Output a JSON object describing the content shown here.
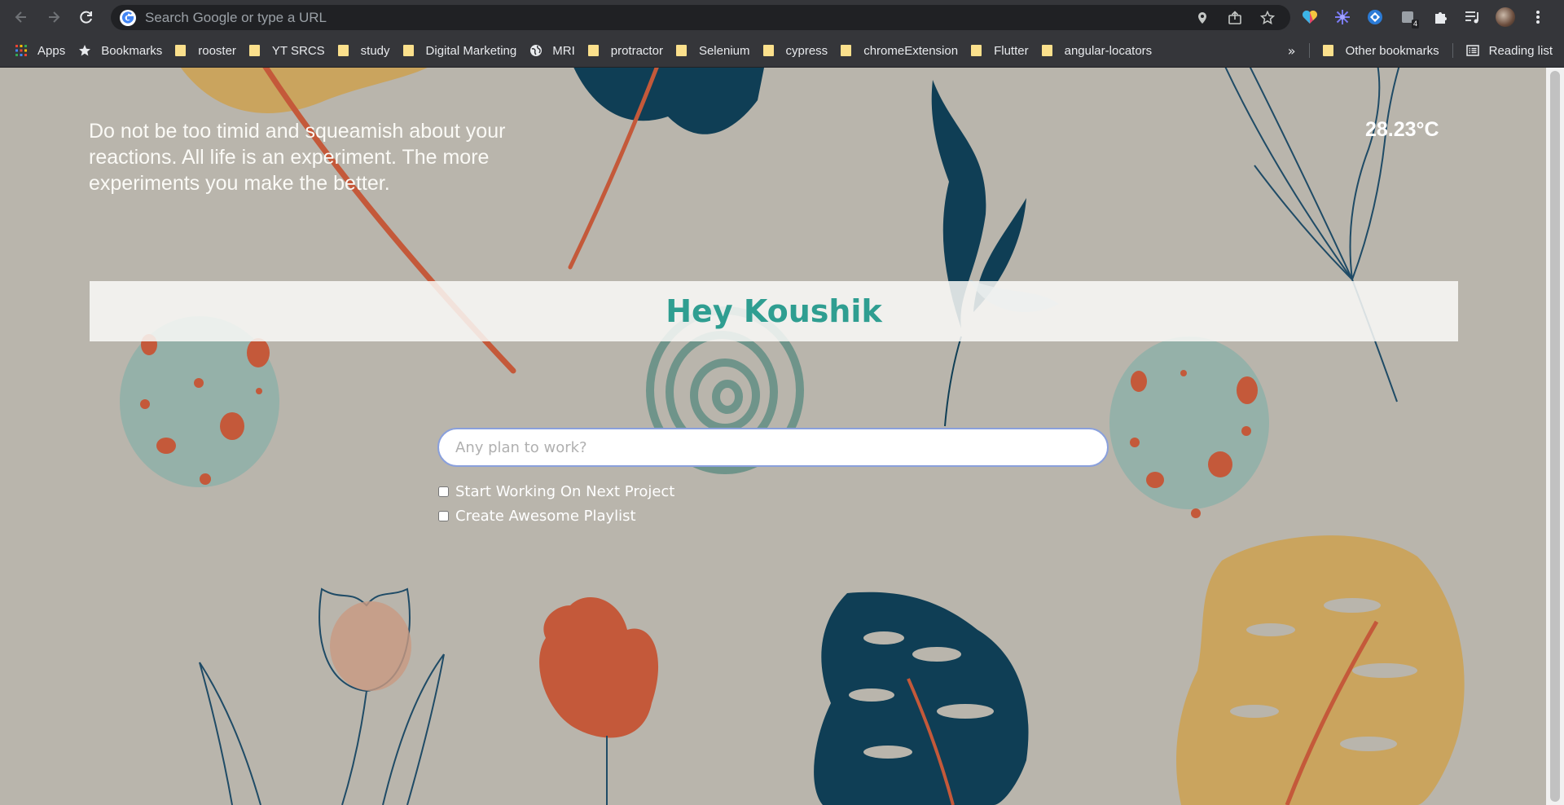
{
  "browser": {
    "omnibox_placeholder": "Search Google or type a URL",
    "extension_badge": "4",
    "bookmarks": [
      {
        "label": "Apps",
        "icon": "apps-grid-icon"
      },
      {
        "label": "Bookmarks",
        "icon": "star-icon"
      },
      {
        "label": "rooster",
        "icon": "folder-icon"
      },
      {
        "label": "YT SRCS",
        "icon": "folder-icon"
      },
      {
        "label": "study",
        "icon": "folder-icon"
      },
      {
        "label": "Digital Marketing",
        "icon": "folder-icon"
      },
      {
        "label": "MRI",
        "icon": "globe-icon"
      },
      {
        "label": "protractor",
        "icon": "folder-icon"
      },
      {
        "label": "Selenium",
        "icon": "folder-icon"
      },
      {
        "label": "cypress",
        "icon": "folder-icon"
      },
      {
        "label": "chromeExtension",
        "icon": "folder-icon"
      },
      {
        "label": "Flutter",
        "icon": "folder-icon"
      },
      {
        "label": "angular-locators",
        "icon": "folder-icon"
      }
    ],
    "more_label": "»",
    "other_bookmarks": "Other bookmarks",
    "reading_list": "Reading list"
  },
  "page": {
    "quote": "Do not be too timid and squeamish about your reactions. All life is an experiment. The more experiments you make the better.",
    "temperature": "28.23°C",
    "greeting": "Hey Koushik",
    "task_placeholder": "Any plan to work?",
    "todos": [
      {
        "label": "Start Working On Next Project",
        "checked": false
      },
      {
        "label": "Create Awesome Playlist",
        "checked": false
      }
    ]
  },
  "colors": {
    "background": "#b9b5ac",
    "greeting": "#2f9e91",
    "leaf_blue": "#0f3e55",
    "leaf_gold": "#caa45e",
    "accent_orange": "#c4593a",
    "sage": "#95b1a9"
  }
}
